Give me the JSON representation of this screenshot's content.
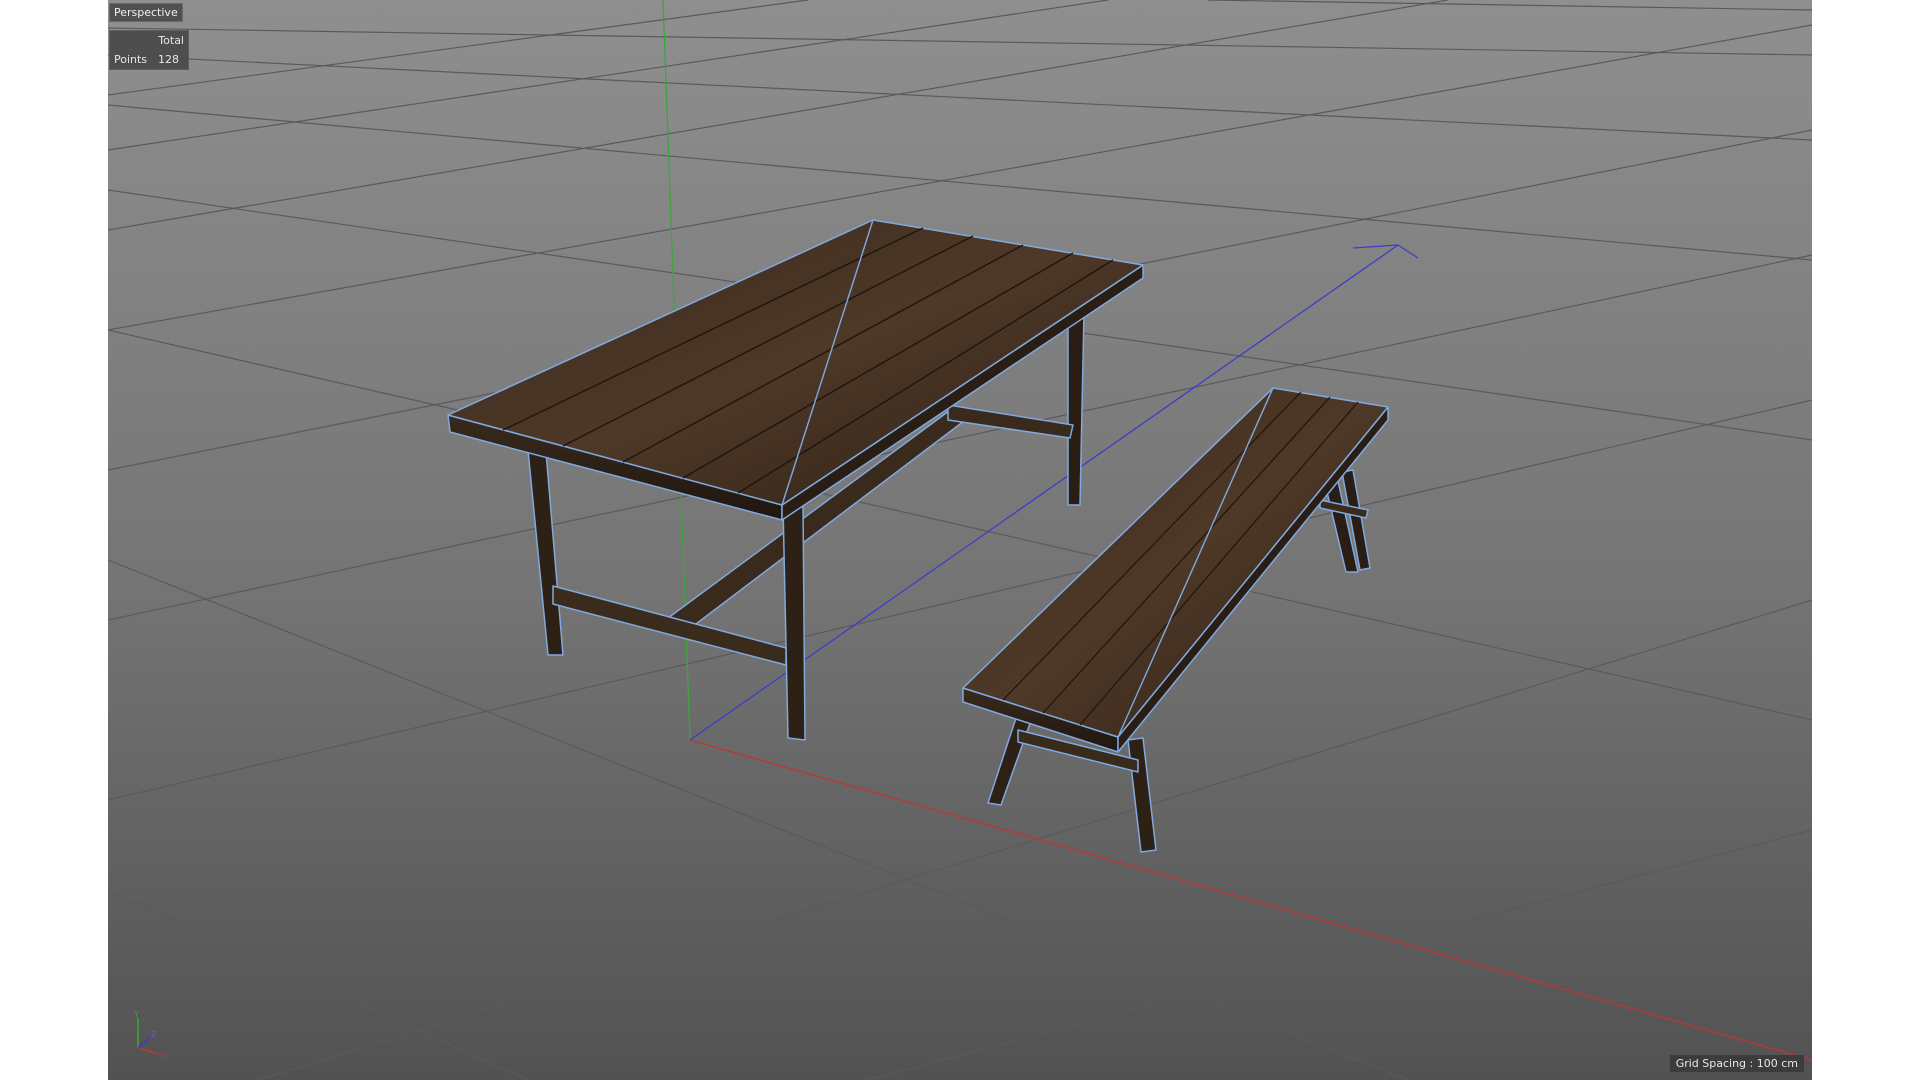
{
  "viewport": {
    "name": "Perspective",
    "grid_spacing": "Grid Spacing : 100 cm"
  },
  "stats": {
    "header": "Total",
    "label": "Points",
    "value": "128"
  },
  "axes": {
    "x": "X",
    "y": "Y",
    "z": "Z"
  },
  "colors": {
    "background_top": "#8f8f8f",
    "background_bottom": "#555555",
    "grid": "#5c5c5c",
    "axis_x": "#c0352e",
    "axis_y": "#3ca63c",
    "axis_z": "#3d3dc8",
    "wireframe": "#7fa9df",
    "wood_dark": "#2d2116",
    "wood_mid": "#4a3526"
  }
}
